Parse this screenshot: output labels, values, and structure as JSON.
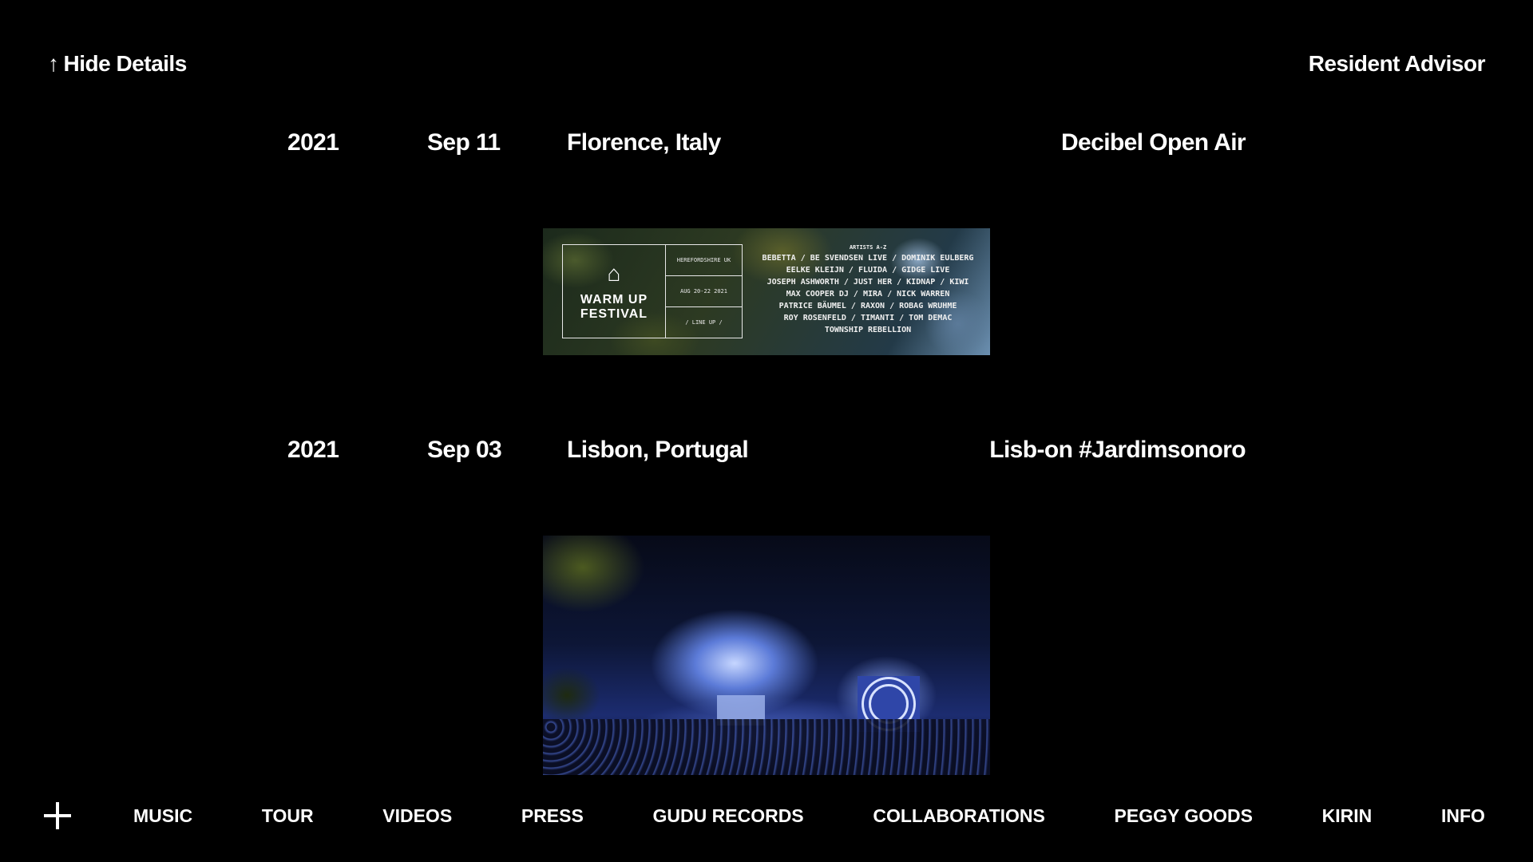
{
  "header": {
    "hide_details_label": "Hide Details",
    "hide_details_icon": "arrow-up-icon",
    "link_label": "Resident Advisor"
  },
  "entries": [
    {
      "year": "2021",
      "date": "Sep 11",
      "location": "Florence, Italy",
      "event": "Decibel Open Air",
      "poster": {
        "festival_name_line1": "WARM UP",
        "festival_name_line2": "FESTIVAL",
        "box_line1": "HEREFORDSHIRE UK",
        "box_line2": "AUG 20-22 2021",
        "box_line3": "/ LINE UP /",
        "lineup_heading": "ARTISTS A-Z",
        "lineup": [
          "BEBETTA / BE SVENDSEN LIVE / DOMINIK EULBERG",
          "EELKE KLEIJN / FLUIDA / GIDGE LIVE",
          "JOSEPH ASHWORTH / JUST HER / KIDNAP / KIWI",
          "MAX COOPER DJ / MIRA / NICK WARREN",
          "PATRICE BÄUMEL / RAXON / ROBAG WRUHME",
          "ROY ROSENFELD / TIMANTI / TOM DEMAC",
          "TOWNSHIP REBELLION"
        ]
      }
    },
    {
      "year": "2021",
      "date": "Sep 03",
      "location": "Lisbon, Portugal",
      "event": "Lisb-on #Jardimsonoro"
    }
  ],
  "nav": {
    "plus_icon": "plus-icon",
    "items": [
      "MUSIC",
      "TOUR",
      "VIDEOS",
      "PRESS",
      "GUDU RECORDS",
      "COLLABORATIONS",
      "PEGGY GOODS",
      "KIRIN",
      "INFO"
    ]
  }
}
